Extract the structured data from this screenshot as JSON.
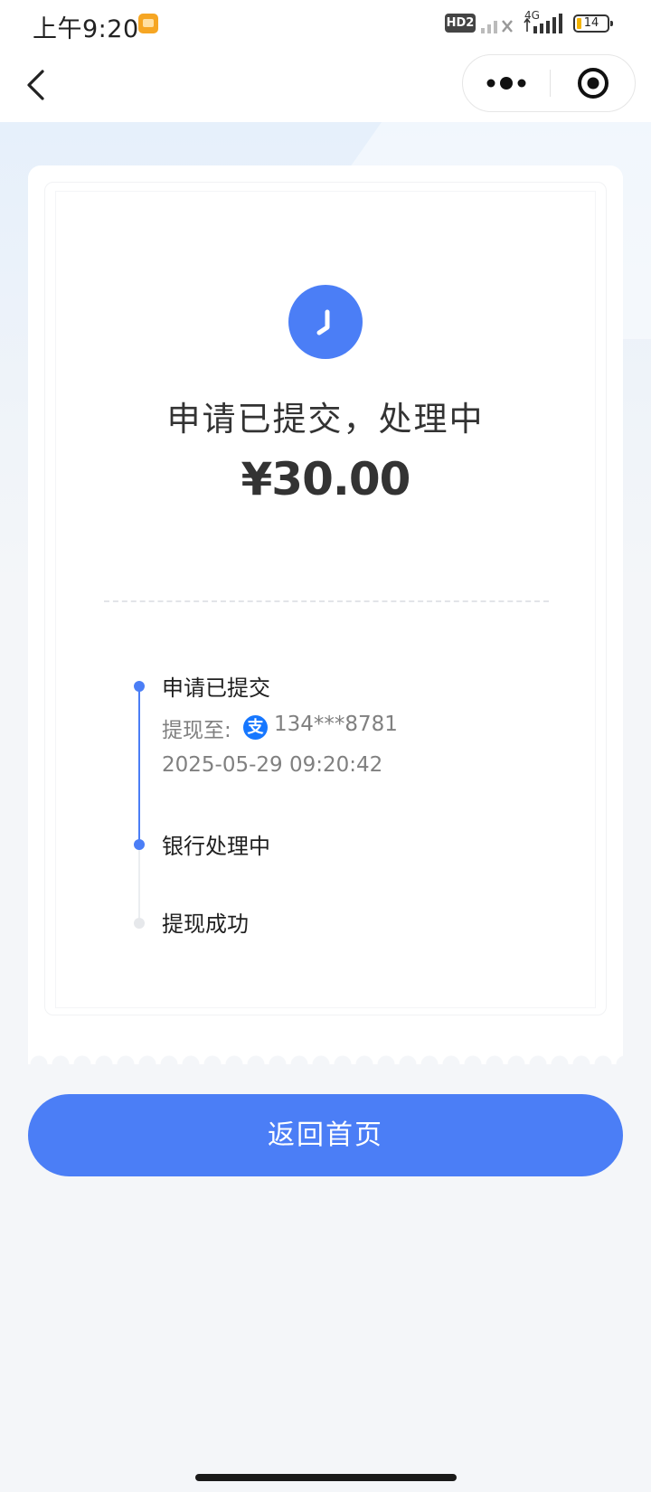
{
  "status_bar": {
    "time": "上午9:20",
    "hd_label": "HD2",
    "network_type": "4G",
    "battery_level": "14"
  },
  "icons": {
    "back": "chevron-left-icon",
    "more": "more-dots-icon",
    "close": "target-circle-icon",
    "status": "clock-icon",
    "payment": "alipay-icon"
  },
  "result": {
    "title": "申请已提交，处理中",
    "amount": "¥30.00"
  },
  "timeline": {
    "steps": [
      {
        "label": "申请已提交",
        "state": "done"
      },
      {
        "label": "银行处理中",
        "state": "current"
      },
      {
        "label": "提现成功",
        "state": "pending"
      }
    ],
    "account_prefix": "提现至:",
    "payment_glyph": "支",
    "account_number": "134***8781",
    "submitted_at": "2025-05-29 09:20:42"
  },
  "actions": {
    "home_button": "返回首页"
  },
  "colors": {
    "accent": "#4b7ef6",
    "alipay": "#1677ff",
    "pending": "#e6e8eb",
    "background": "#f4f6f9"
  }
}
